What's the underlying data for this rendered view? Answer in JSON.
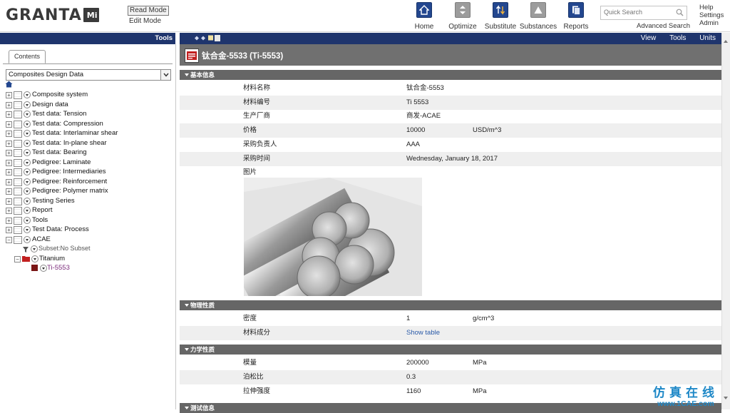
{
  "header": {
    "logo": "GRANTA",
    "logo_badge": "Mi",
    "modes": [
      "Read Mode",
      "Edit Mode"
    ],
    "nav": [
      {
        "label": "Home",
        "icon": "home-icon"
      },
      {
        "label": "Optimize",
        "icon": "optimize-icon"
      },
      {
        "label": "Substitute",
        "icon": "substitute-icon"
      },
      {
        "label": "Substances",
        "icon": "substances-icon"
      },
      {
        "label": "Reports",
        "icon": "reports-icon"
      }
    ],
    "quick_search_placeholder": "Quick Search",
    "advanced_search": "Advanced Search",
    "links": [
      "Help",
      "Settings",
      "Admin"
    ]
  },
  "left": {
    "bar_title": "Tools",
    "tab": "Contents",
    "database": "Composites Design Data",
    "tree": [
      "Composite system",
      "Design data",
      "Test data: Tension",
      "Test data: Compression",
      "Test data: Interlaminar shear",
      "Test data: In-plane shear",
      "Test data: Bearing",
      "Pedigree: Laminate",
      "Pedigree: Intermediaries",
      "Pedigree: Reinforcement",
      "Pedigree: Polymer matrix",
      "Testing Series",
      "Report",
      "Tools",
      "Test Data: Process",
      "ACAE"
    ],
    "subset": "Subset:No Subset",
    "folder": "Titanium",
    "record": "Ti-5553"
  },
  "right": {
    "bar_links": [
      "View",
      "Tools",
      "Units"
    ],
    "record_title": "钛合金-5533 (Ti-5553)",
    "sections": [
      {
        "title": "基本信息",
        "rows": [
          {
            "name": "材料名称",
            "value": "钛合金-5553",
            "unit": ""
          },
          {
            "name": "材料编号",
            "value": "Ti 5553",
            "unit": ""
          },
          {
            "name": "生产厂商",
            "value": "商发-ACAE",
            "unit": ""
          },
          {
            "name": "价格",
            "value": "10000",
            "unit": "USD/m^3"
          },
          {
            "name": "采购负责人",
            "value": "AAA",
            "unit": ""
          },
          {
            "name": "采购时间",
            "value": "Wednesday, January 18, 2017",
            "unit": ""
          },
          {
            "name": "图片",
            "value": "",
            "unit": ""
          }
        ]
      },
      {
        "title": "物理性质",
        "rows": [
          {
            "name": "密度",
            "value": "1",
            "unit": "g/cm^3"
          },
          {
            "name": "材料成分",
            "value": "Show table",
            "unit": ""
          }
        ]
      },
      {
        "title": "力学性质",
        "rows": [
          {
            "name": "模量",
            "value": "200000",
            "unit": "MPa"
          },
          {
            "name": "泊松比",
            "value": "0.3",
            "unit": ""
          },
          {
            "name": "拉伸强度",
            "value": "1160",
            "unit": "MPa"
          }
        ]
      },
      {
        "title": "测试信息",
        "rows": []
      }
    ]
  },
  "watermark": {
    "cn": "仿真在线",
    "url": "www.1CAE.com"
  }
}
